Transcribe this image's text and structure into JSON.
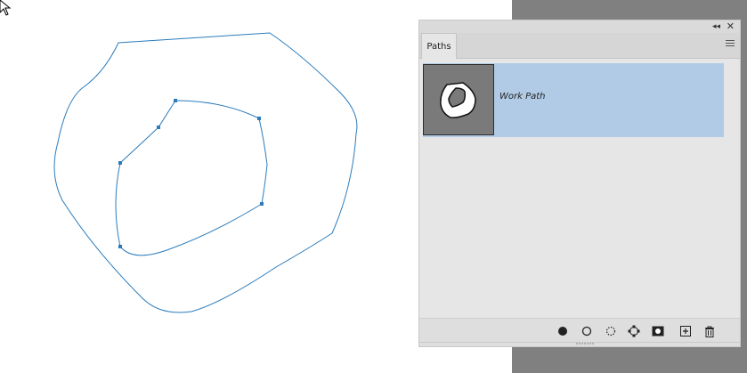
{
  "panel": {
    "tab_label": "Paths",
    "collapse_icon": "double-chevron-left-icon",
    "close_icon": "close-icon",
    "menu_icon": "panel-menu-icon",
    "paths": [
      {
        "name": "Work Path",
        "selected": true
      }
    ],
    "tools": [
      {
        "name": "fill-path-icon"
      },
      {
        "name": "stroke-path-icon"
      },
      {
        "name": "load-path-as-selection-icon"
      },
      {
        "name": "make-work-path-icon"
      },
      {
        "name": "add-mask-icon"
      },
      {
        "name": "create-new-path-icon"
      },
      {
        "name": "delete-path-icon"
      }
    ]
  },
  "colors": {
    "path_stroke": "#1f77b4",
    "selected_row": "#b1cbe6",
    "panel_bg": "#e6e6e6",
    "gray_area": "#808080"
  }
}
